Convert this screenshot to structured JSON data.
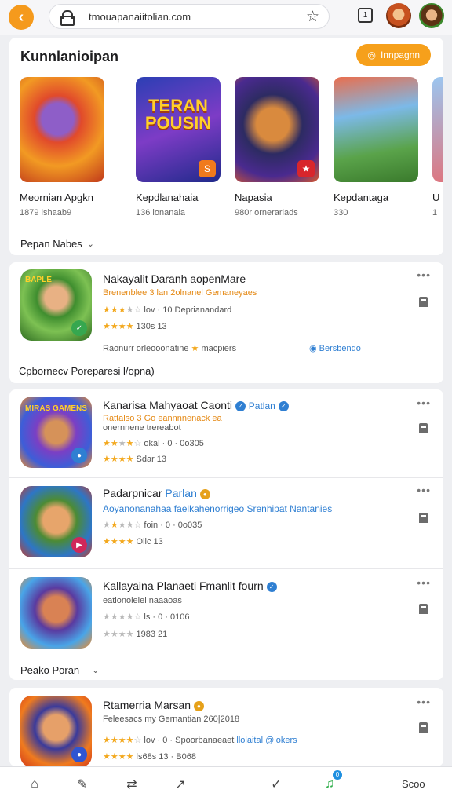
{
  "browser": {
    "url": "tmouapanaiitolian.com",
    "back_icon": "chevron-left-icon",
    "tab_count": "1"
  },
  "featured": {
    "title": "Kunnlanioipan",
    "button_label": "Innpagnn",
    "games": [
      {
        "name": "Meornian Apgkn",
        "sub": "1879 lshaab9"
      },
      {
        "name": "Kepdlanahaia",
        "sub": "136 lonanaia"
      },
      {
        "name": "Napasia",
        "sub": "980r ornerariads"
      },
      {
        "name": "Kepdantaga",
        "sub": "330"
      },
      {
        "name": "U",
        "sub": "1"
      }
    ],
    "logo_text": "TERAN POUSIN"
  },
  "section_popular": {
    "label": "Pepan Nabes"
  },
  "app1": {
    "title": "Nakayalit Daranh aopenMare",
    "subtitle": "Brenenblee 3 lan 2olnanel Gemaneyaes",
    "rating_line": "lov · 10 Deprianandard",
    "count": "130s 13",
    "footer_left": "Raonurr orleooonatine",
    "footer_mid": "macpiers",
    "footer_right": "Bersbendo",
    "icon_text": "BAPLE"
  },
  "section_community": {
    "label": "Cpbornecv Poreparesi l/opna)"
  },
  "app2": {
    "title": "Kanarisa Mahyaoat Caonti",
    "title_tag": "Patlan",
    "subtitle": "Rattalso 3 Go eannnnenack ea",
    "subtitle2": "onernnene trereabot",
    "rating_line": "okal · 0 · 0o305",
    "count": "Sdar 13",
    "icon_text": "MIRAS GAMENS"
  },
  "app3": {
    "title": "Padarpnicar",
    "title_tag": "Parlan",
    "subtitle": "Aoyanonanahaa faelkahenorrigeo Srenhipat Nantanies",
    "rating_line": "foin · 0 · 0o035",
    "count": "Oilc 13"
  },
  "app4": {
    "title": "Kallayaina Planaeti Fmanlit fourn",
    "subtitle": "eatlonolelel naaaoas",
    "rating_line": "ls · 0 · 0106",
    "count": "1983 21"
  },
  "section_peako": {
    "label": "Peako Poran"
  },
  "app5": {
    "title": "Rtamerria Marsan",
    "subtitle": "Feleesacs my Gernantian 260|2018",
    "rating_line": "lov · 0 · Spoorbanaeaet",
    "link_text": "llolaital @lokers",
    "count": "ls68s 13 · B068"
  },
  "bottom_nav": {
    "label": "Scoo"
  },
  "colors": {
    "accent": "#f59a1c",
    "blue": "#2f7fd2",
    "star": "#f3a81d"
  }
}
